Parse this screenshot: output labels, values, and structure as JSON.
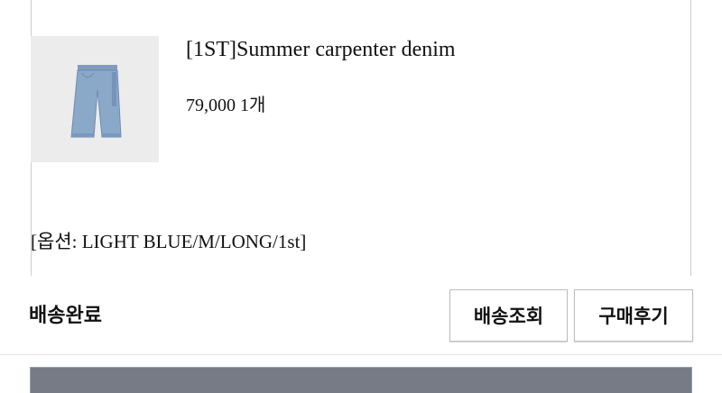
{
  "order_item": {
    "product_name": "[1ST]Summer carpenter denim",
    "price_quantity": "79,000 1개",
    "option": "[옵션: LIGHT BLUE/M/LONG/1st]",
    "thumbnail_icon": "denim-pants-image"
  },
  "status": {
    "label": "배송완료"
  },
  "actions": {
    "track_label": "배송조회",
    "review_label": "구매후기"
  },
  "colors": {
    "denim": "#8aa8c8",
    "thumbnail_bg": "#ececec",
    "bottom_bar": "#767b86"
  }
}
